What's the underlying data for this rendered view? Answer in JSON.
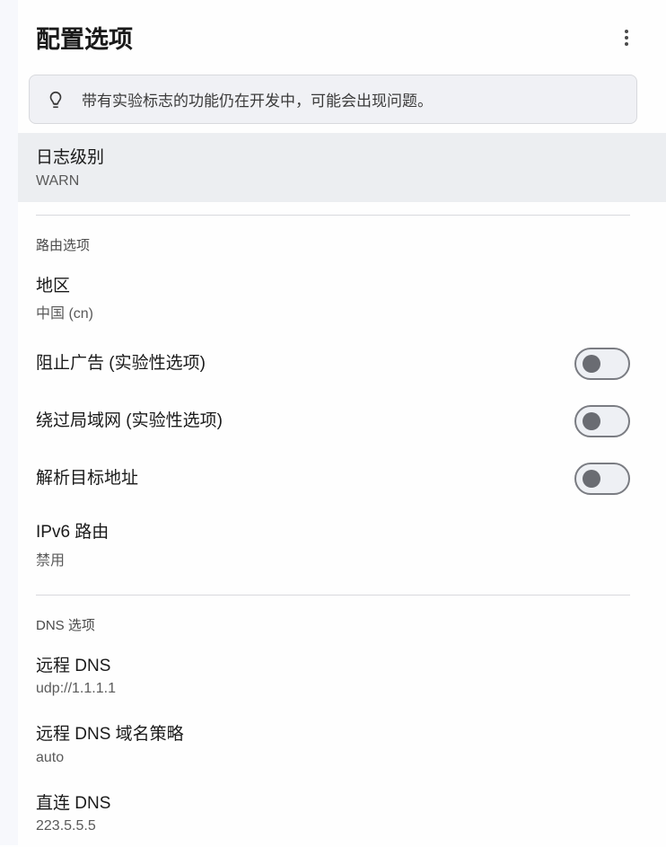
{
  "header": {
    "title": "配置选项"
  },
  "banner": {
    "text": "带有实验标志的功能仍在开发中，可能会出现问题。"
  },
  "logLevel": {
    "title": "日志级别",
    "value": "WARN"
  },
  "routing": {
    "sectionTitle": "路由选项",
    "region": {
      "title": "地区",
      "value": "中国 (cn)"
    },
    "blockAds": {
      "title": "阻止广告 (实验性选项)",
      "enabled": false
    },
    "bypassLan": {
      "title": "绕过局域网 (实验性选项)",
      "enabled": false
    },
    "resolveTarget": {
      "title": "解析目标地址",
      "enabled": false
    },
    "ipv6": {
      "title": "IPv6 路由",
      "value": "禁用"
    }
  },
  "dns": {
    "sectionTitle": "DNS 选项",
    "remoteDns": {
      "title": "远程 DNS",
      "value": "udp://1.1.1.1"
    },
    "remoteDnsPolicy": {
      "title": "远程 DNS 域名策略",
      "value": "auto"
    },
    "directDns": {
      "title": "直连 DNS",
      "value": "223.5.5.5"
    }
  }
}
